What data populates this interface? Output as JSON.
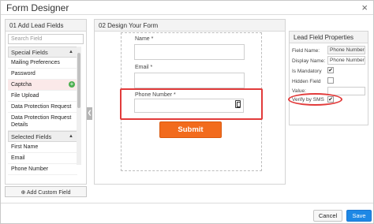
{
  "title": "Form Designer",
  "close": "×",
  "left_panel": {
    "heading": "01 Add Lead Fields",
    "search_placeholder": "Search Field",
    "special_group": "Special Fields",
    "special_items": [
      "Mailing Preferences",
      "Password",
      "Captcha",
      "File Upload",
      "Data Protection Request",
      "Data Protection Request Details"
    ],
    "selected_group": "Selected Fields",
    "selected_items": [
      "First Name",
      "Email",
      "Phone Number"
    ],
    "add_custom": "Add Custom Field",
    "add_custom_icon": "⊕",
    "chevron": "▲",
    "add_icon": "+"
  },
  "collapse": "❮",
  "middle_panel": {
    "heading": "02 Design Your Form",
    "name_label": "Name *",
    "email_label": "Email *",
    "phone_label": "Phone Number *",
    "submit": "Submit"
  },
  "right_panel": {
    "heading": "Lead Field Properties",
    "field_name_label": "Field Name:",
    "field_name_value": "Phone Number",
    "display_name_label": "Display Name:",
    "display_name_value": "Phone Number",
    "mandatory_label": "Is Mandatory",
    "hidden_label": "Hidden Field",
    "value_label": "Value:",
    "sms_label": "Verify by SMS",
    "check": "✔"
  },
  "footer": {
    "cancel": "Cancel",
    "save": "Save"
  },
  "colors": {
    "submit": "#f26b1d",
    "save": "#1e88e5",
    "highlight": "#e23b3b"
  }
}
